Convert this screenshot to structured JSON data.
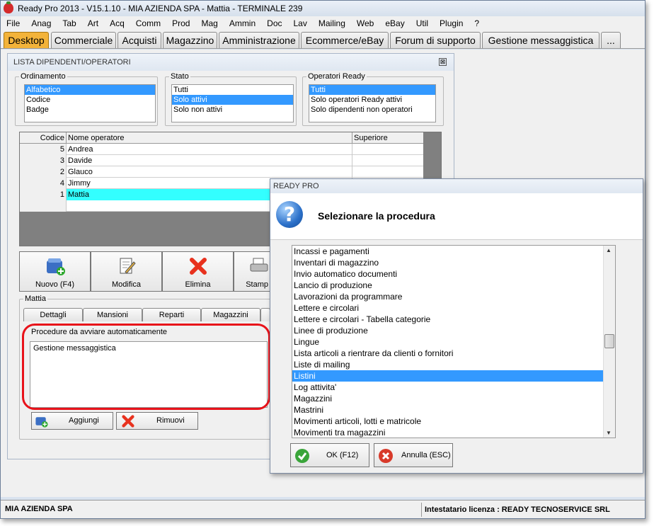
{
  "window": {
    "title": "Ready Pro 2013 - V15.1.10 - MIA AZIENDA SPA - Mattia - TERMINALE 239"
  },
  "menu": [
    "File",
    "Anag",
    "Tab",
    "Art",
    "Acq",
    "Comm",
    "Prod",
    "Mag",
    "Ammin",
    "Doc",
    "Lav",
    "Mailing",
    "Web",
    "eBay",
    "Util",
    "Plugin",
    "?"
  ],
  "tabs": [
    {
      "label": "Desktop",
      "active": true
    },
    {
      "label": "Commerciale"
    },
    {
      "label": "Acquisti"
    },
    {
      "label": "Magazzino"
    },
    {
      "label": "Amministrazione"
    },
    {
      "label": "Ecommerce/eBay"
    },
    {
      "label": "Forum di supporto"
    },
    {
      "label": "Gestione messaggistica"
    },
    {
      "label": "..."
    }
  ],
  "list_window": {
    "title": "LISTA DIPENDENTI/OPERATORI",
    "close": "⊠",
    "ordinamento": {
      "legend": "Ordinamento",
      "items": [
        "Alfabetico",
        "Codice",
        "Badge"
      ],
      "selected": 0
    },
    "stato": {
      "legend": "Stato",
      "items": [
        "Tutti",
        "Solo attivi",
        "Solo non attivi"
      ],
      "selected": 1
    },
    "operatori": {
      "legend": "Operatori Ready",
      "items": [
        "Tutti",
        "Solo operatori Ready attivi",
        "Solo dipendenti non operatori"
      ],
      "selected": 0
    },
    "grid": {
      "columns": [
        "Codice",
        "Nome operatore",
        "Superiore"
      ],
      "rows": [
        {
          "code": "5",
          "name": "Andrea",
          "sup": ""
        },
        {
          "code": "3",
          "name": "Davide",
          "sup": ""
        },
        {
          "code": "2",
          "name": "Glauco",
          "sup": ""
        },
        {
          "code": "4",
          "name": "Jimmy",
          "sup": ""
        },
        {
          "code": "1",
          "name": "Mattia",
          "sup": "",
          "selected": true
        }
      ]
    },
    "buttons": {
      "nuovo": "Nuovo (F4)",
      "modifica": "Modifica",
      "elimina": "Elimina",
      "stampa": "Stamp"
    },
    "detail": {
      "legend": "Mattia",
      "tabs": [
        "Dettagli",
        "Mansioni",
        "Reparti",
        "Magazzini"
      ],
      "procedures_label": "Procedure da avviare automaticamente",
      "procedures": [
        "Gestione messaggistica"
      ],
      "add": "Aggiungi",
      "remove": "Rimuovi"
    }
  },
  "dialog": {
    "caption": "READY PRO",
    "title": "Selezionare la procedura",
    "icon": "question-icon",
    "items": [
      "Incassi e pagamenti",
      "Inventari di magazzino",
      "Invio automatico documenti",
      "Lancio di produzione",
      "Lavorazioni da programmare",
      "Lettere e circolari",
      "Lettere e circolari - Tabella categorie",
      "Linee di produzione",
      "Lingue",
      "Lista articoli a rientrare da clienti o fornitori",
      "Liste di mailing",
      "Listini",
      "Log attivita'",
      "Magazzini",
      "Mastrini",
      "Movimenti articoli, lotti e matricole",
      "Movimenti tra magazzini"
    ],
    "selected_index": 11,
    "ok": "OK (F12)",
    "cancel": "Annulla (ESC)"
  },
  "status": {
    "company": "MIA AZIENDA SPA",
    "license": "Intestatario licenza : READY TECNOSERVICE SRL"
  },
  "colors": {
    "active_tab": "#f3b33a",
    "selection_blue": "#3399ff",
    "selected_row": "#33ffff",
    "highlight_oval": "#e8121a"
  }
}
